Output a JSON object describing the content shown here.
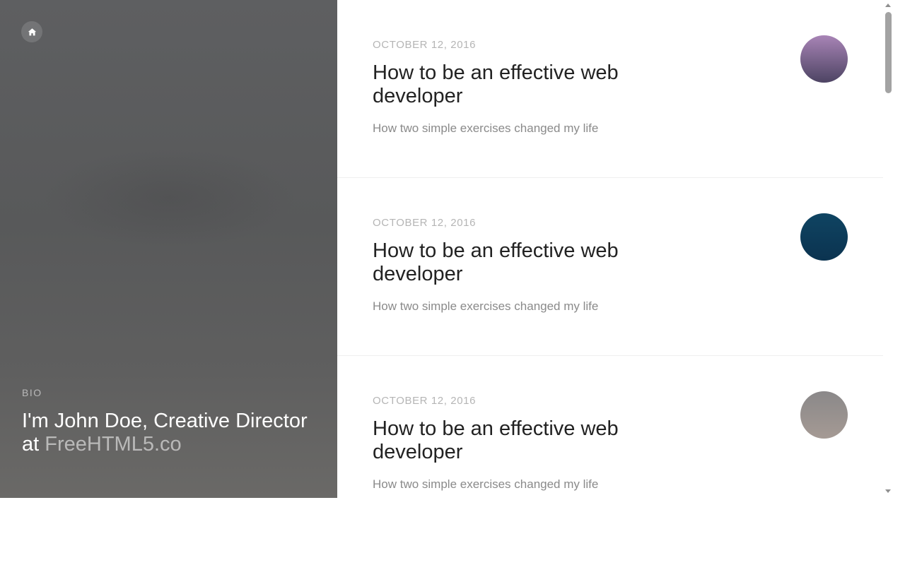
{
  "hero": {
    "home_icon": "home-icon",
    "bio_label": "BIO",
    "bio_text_prefix": "I'm John Doe, Creative Director at ",
    "bio_link": "FreeHTML5.co"
  },
  "posts": [
    {
      "date": "OCTOBER 12, 2016",
      "title": "How to be an effective web developer",
      "subtitle": "How two simple exercises changed my life",
      "thumb_colors": [
        "#a884b6",
        "#4d4463"
      ]
    },
    {
      "date": "OCTOBER 12, 2016",
      "title": "How to be an effective web developer",
      "subtitle": "How two simple exercises changed my life",
      "thumb_colors": [
        "#0f4462",
        "#0b3350"
      ]
    },
    {
      "date": "OCTOBER 12, 2016",
      "title": "How to be an effective web developer",
      "subtitle": "How two simple exercises changed my life",
      "thumb_colors": [
        "#8a8889",
        "#a59a94"
      ]
    }
  ],
  "scrollbar": {
    "position_fraction": 0.0
  }
}
